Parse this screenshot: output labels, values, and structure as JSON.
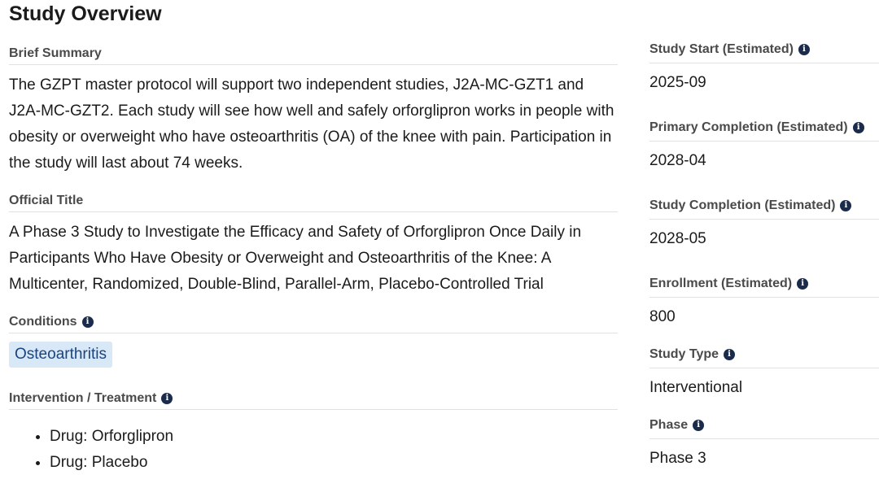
{
  "page": {
    "title": "Study Overview"
  },
  "brief_summary": {
    "label": "Brief Summary",
    "text": "The GZPT master protocol will support two independent studies, J2A-MC-GZT1 and J2A-MC-GZT2. Each study will see how well and safely orforglipron works in people with obesity or overweight who have osteoarthritis (OA) of the knee with pain. Participation in the study will last about 74 weeks."
  },
  "official_title": {
    "label": "Official Title",
    "text": "A Phase 3 Study to Investigate the Efficacy and Safety of Orforglipron Once Daily in Participants Who Have Obesity or Overweight and Osteoarthritis of the Knee: A Multicenter, Randomized, Double-Blind, Parallel-Arm, Placebo-Controlled Trial"
  },
  "conditions": {
    "label": "Conditions",
    "items": [
      "Osteoarthritis"
    ]
  },
  "intervention": {
    "label": "Intervention / Treatment",
    "items": [
      "Drug: Orforglipron",
      "Drug: Placebo"
    ]
  },
  "sidebar": {
    "study_start": {
      "label": "Study Start (Estimated)",
      "value": "2025-09"
    },
    "primary_completion": {
      "label": "Primary Completion (Estimated)",
      "value": "2028-04"
    },
    "study_completion": {
      "label": "Study Completion (Estimated)",
      "value": "2028-05"
    },
    "enrollment": {
      "label": "Enrollment (Estimated)",
      "value": "800"
    },
    "study_type": {
      "label": "Study Type",
      "value": "Interventional"
    },
    "phase": {
      "label": "Phase",
      "value": "Phase 3"
    }
  },
  "icons": {
    "info": "info-icon"
  },
  "colors": {
    "tag_background": "#d9e8f6",
    "tag_text": "#1a4480",
    "info_icon": "#1b2b4b",
    "divider": "#dfe1e2"
  }
}
